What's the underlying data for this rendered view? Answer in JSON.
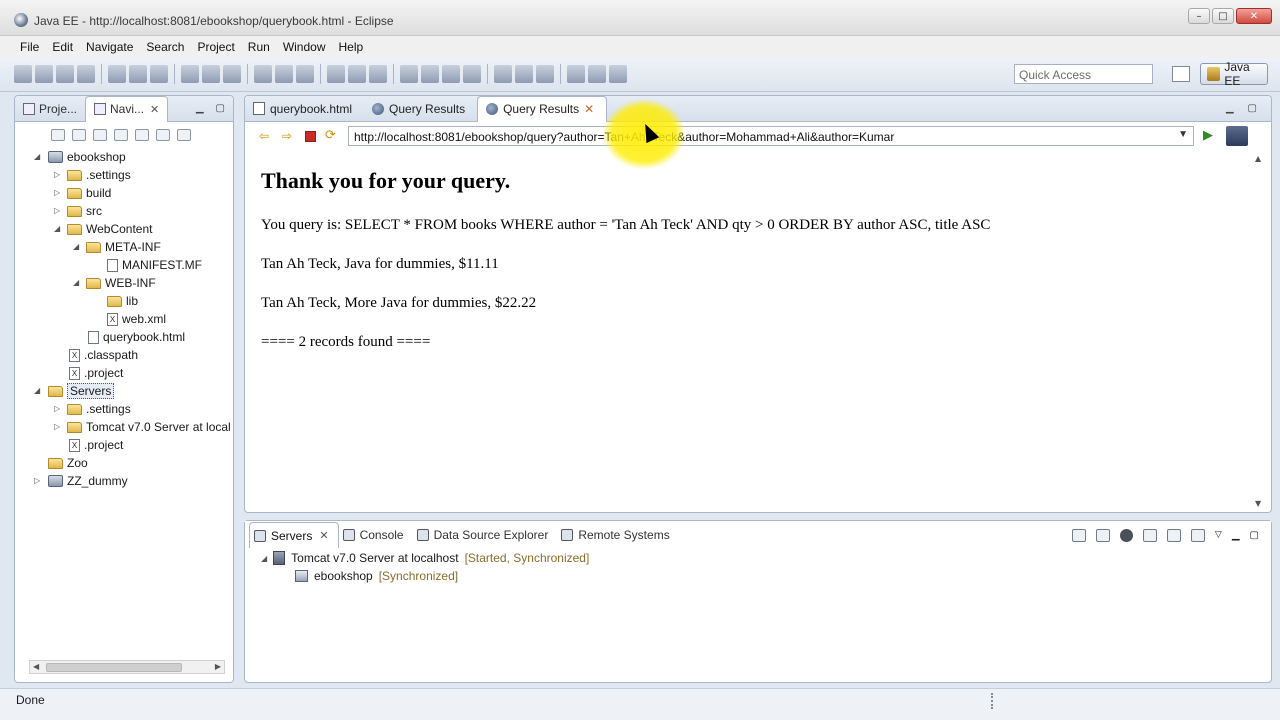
{
  "window": {
    "title": "Java EE - http://localhost:8081/ebookshop/querybook.html - Eclipse"
  },
  "menu": [
    "File",
    "Edit",
    "Navigate",
    "Search",
    "Project",
    "Run",
    "Window",
    "Help"
  ],
  "toolbar": {
    "quick_access_placeholder": "Quick Access",
    "perspective_label": "Java EE"
  },
  "left_panel": {
    "tabs": [
      {
        "label": "Proje..."
      },
      {
        "label": "Navi..."
      }
    ],
    "tree": [
      {
        "label": "ebookshop",
        "icon": "project-icon",
        "expanded": true
      },
      {
        "label": ".settings",
        "icon": "folder-icon",
        "expanded": false
      },
      {
        "label": "build",
        "icon": "folder-icon",
        "expanded": false
      },
      {
        "label": "src",
        "icon": "folder-icon",
        "expanded": false
      },
      {
        "label": "WebContent",
        "icon": "folder-icon",
        "expanded": true
      },
      {
        "label": "META-INF",
        "icon": "folder-icon",
        "expanded": true
      },
      {
        "label": "MANIFEST.MF",
        "icon": "file-icon"
      },
      {
        "label": "WEB-INF",
        "icon": "folder-icon",
        "expanded": true
      },
      {
        "label": "lib",
        "icon": "folder-icon"
      },
      {
        "label": "web.xml",
        "icon": "xml-file-icon"
      },
      {
        "label": "querybook.html",
        "icon": "html-file-icon"
      },
      {
        "label": ".classpath",
        "icon": "xml-file-icon"
      },
      {
        "label": ".project",
        "icon": "xml-file-icon"
      },
      {
        "label": "Servers",
        "icon": "project-icon",
        "expanded": true,
        "selected": true
      },
      {
        "label": ".settings",
        "icon": "folder-icon",
        "expanded": false
      },
      {
        "label": "Tomcat v7.0 Server at local",
        "icon": "folder-icon",
        "expanded": false
      },
      {
        "label": ".project",
        "icon": "xml-file-icon"
      },
      {
        "label": "Zoo",
        "icon": "project-icon"
      },
      {
        "label": "ZZ_dummy",
        "icon": "project-icon",
        "expanded": false
      }
    ]
  },
  "editor": {
    "tabs": [
      {
        "label": "querybook.html"
      },
      {
        "label": "Query Results"
      },
      {
        "label": "Query Results"
      }
    ],
    "url": "http://localhost:8081/ebookshop/query?author=Tan+Ah+Teck&author=Mohammad+Ali&author=Kumar",
    "page": {
      "heading": "Thank you for your query.",
      "query_line": "You query is: SELECT * FROM books WHERE author = 'Tan Ah Teck' AND qty > 0 ORDER BY author ASC, title ASC",
      "results": [
        "Tan Ah Teck, Java for dummies, $11.11",
        "Tan Ah Teck, More Java for dummies, $22.22"
      ],
      "footer": "==== 2 records found ===="
    }
  },
  "bottom_panel": {
    "tabs": [
      {
        "label": "Servers"
      },
      {
        "label": "Console"
      },
      {
        "label": "Data Source Explorer"
      },
      {
        "label": "Remote Systems"
      }
    ],
    "server": {
      "name": "Tomcat v7.0 Server at localhost",
      "status": "[Started, Synchronized]"
    },
    "module": {
      "name": "ebookshop",
      "status": "[Synchronized]"
    }
  },
  "statusbar": {
    "text": "Done"
  }
}
